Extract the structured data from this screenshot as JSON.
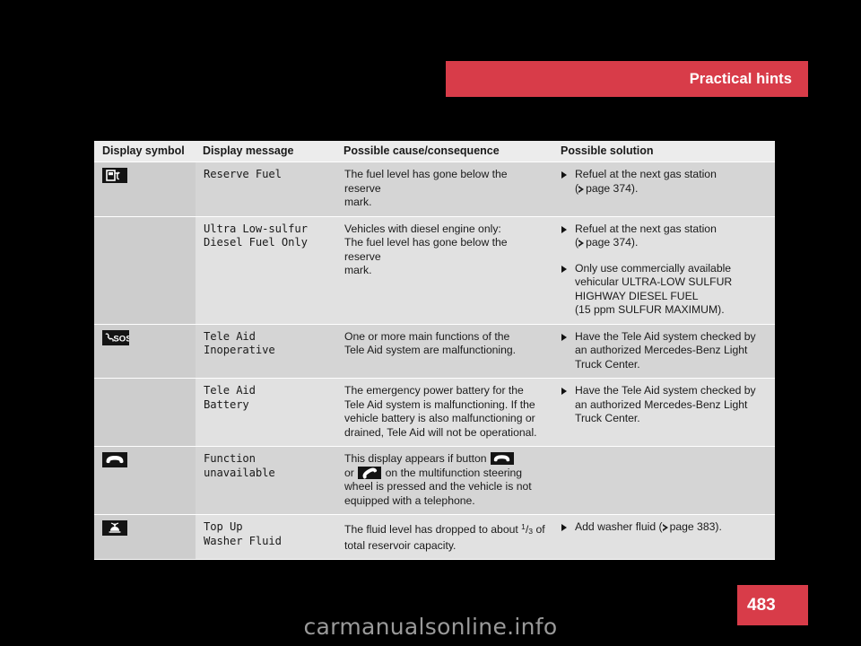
{
  "header": {
    "title": "Practical hints"
  },
  "page": {
    "number": "483",
    "watermark": "carmanualsonline.info"
  },
  "colors": {
    "accent_red": "#d83c49",
    "header_text": "#ffffff",
    "table_header_bg": "#ececec",
    "row_band_a": "#d5d5d5",
    "row_band_b": "#e1e1e1",
    "symbol_column_bg": "#cdcdcd",
    "icon_tile_bg": "#141414",
    "display_message_text": "#5e5e5e",
    "body_text": "#1a1a1a",
    "watermark_text": "#9a9a9a"
  },
  "table": {
    "columns": [
      "Display symbol",
      "Display message",
      "Possible cause/consequence",
      "Possible solution"
    ],
    "rows": [
      {
        "symbol_icon": "fuel-pump-icon",
        "message": "Reserve Fuel",
        "cause": "The fuel level has gone below the reserve mark.",
        "solutions": [
          "Refuel at the next gas station (▷ page 374)."
        ],
        "solution_lines": [
          [
            "Refuel at the next gas station",
            "page 374"
          ]
        ]
      },
      {
        "symbol_icon": "",
        "message": "Ultra Low-sulfur\nDiesel Fuel Only",
        "cause": "Vehicles with diesel engine only:\nThe fuel level has gone below the reserve mark.",
        "solutions": [
          "Refuel at the next gas station (▷ page 374).",
          "Only use commercially available vehicular ULTRA-LOW SULFUR HIGHWAY DIESEL FUEL (15 ppm SULFUR MAXIMUM)."
        ]
      },
      {
        "symbol_icon": "sos-phone-icon",
        "message": "Tele Aid\nInoperative",
        "cause": "One or more main functions of the Tele Aid system are malfunctioning.",
        "solutions": [
          "Have the Tele Aid system checked by an authorized Mercedes-Benz Light Truck Center."
        ]
      },
      {
        "symbol_icon": "",
        "message": "Tele Aid\nBattery",
        "cause": "The emergency power battery for the Tele Aid system is malfunctioning. If the vehicle battery is also malfunctioning or drained, Tele Aid will not be operational.",
        "solutions": [
          "Have the Tele Aid system checked by an authorized Mercedes-Benz Light Truck Center."
        ]
      },
      {
        "symbol_icon": "phone-hangup-icon",
        "message": "Function\nunavailable",
        "cause": "This display appears if button [hangup] or [pickup] on the multifunction steering wheel is pressed and the vehicle is not equipped with a telephone.",
        "solutions": []
      },
      {
        "symbol_icon": "washer-fluid-icon",
        "message": "Top Up\nWasher Fluid",
        "cause": "The fluid level has dropped to about 1/3 of total reservoir capacity.",
        "solutions": [
          "Add washer fluid (▷ page 383)."
        ]
      }
    ],
    "text_fragments": {
      "cause_r1_l1": "The fuel level has gone below the reserve",
      "cause_r1_l2": "mark.",
      "cause_r2_l1": "Vehicles with diesel engine only:",
      "cause_r2_l2": "The fuel level has gone below the reserve",
      "cause_r2_l3": "mark.",
      "cause_r3_l1": "One or more main functions of the",
      "cause_r3_l2": "Tele Aid system are malfunctioning.",
      "cause_r4_l1": "The emergency power battery for the",
      "cause_r4_l2": "Tele Aid system is malfunctioning. If the",
      "cause_r4_l3": "vehicle battery is also malfunctioning or",
      "cause_r4_l4": "drained, Tele Aid will not be operational.",
      "cause_r5_p1": "This display appears if button",
      "cause_r5_p2": "or",
      "cause_r5_p3": "on the multifunction steering",
      "cause_r5_p4": "wheel is pressed and the vehicle is not",
      "cause_r5_p5": "equipped with a telephone.",
      "cause_r6_p1": "The fluid level has dropped to about",
      "cause_r6_num": "1",
      "cause_r6_den": "3",
      "cause_r6_p2": "of",
      "cause_r6_p3": "total reservoir capacity.",
      "sol_refuel": "Refuel at the next gas station",
      "sol_page374_pre": "(",
      "sol_page374": "page 374",
      "sol_page374_post": ").",
      "sol_only_use_l1": "Only use commercially available",
      "sol_only_use_l2": "vehicular ULTRA-LOW SULFUR",
      "sol_only_use_l3": "HIGHWAY DIESEL FUEL",
      "sol_only_use_l4": "(15 ppm SULFUR MAXIMUM).",
      "sol_teleaid_l1": "Have the Tele Aid system checked by",
      "sol_teleaid_l2": "an authorized Mercedes-Benz Light",
      "sol_teleaid_l3": "Truck Center.",
      "sol_washer_pre": "Add washer fluid (",
      "sol_washer_page": "page 383",
      "sol_washer_post": ").",
      "msg_r1": "Reserve Fuel",
      "msg_r2_l1": "Ultra Low-sulfur",
      "msg_r2_l2": "Diesel Fuel Only",
      "msg_r3_l1": "Tele Aid",
      "msg_r3_l2": "Inoperative",
      "msg_r4_l1": "Tele Aid",
      "msg_r4_l2": "Battery",
      "msg_r5_l1": "Function",
      "msg_r5_l2": "unavailable",
      "msg_r6_l1": "Top Up",
      "msg_r6_l2": "Washer Fluid"
    }
  }
}
